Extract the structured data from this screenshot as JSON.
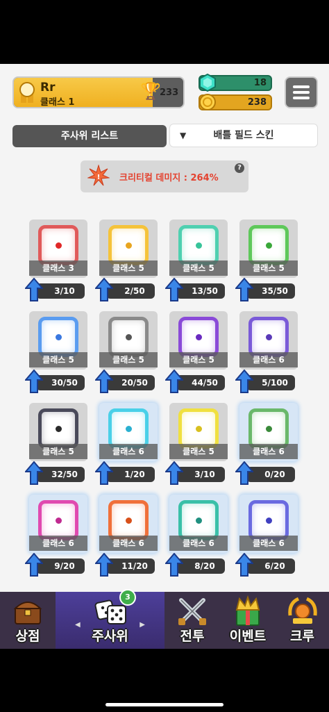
{
  "profile": {
    "name": "Rr",
    "class_label": "클래스 1",
    "trophies": "233",
    "xp_fraction": 0.82
  },
  "currency": {
    "gems": "18",
    "gold": "238"
  },
  "tabs": {
    "dice_list": "주사위 리스트",
    "battle_field_skin": "배틀 필드 스킨"
  },
  "crit": {
    "text": "크리티컬 데미지 : 264%",
    "help": "?"
  },
  "colors": {
    "accent_gold": "#f0b020",
    "gem_green": "#2d8f6a",
    "crit_red": "#e4422f",
    "nav_bg": "#3b3047"
  },
  "dice": [
    {
      "class": "클래스 3",
      "progress": "3/10",
      "color": "#e05a5a",
      "pip": "#e02828",
      "glow": false,
      "icon": "fire-dice-icon"
    },
    {
      "class": "클래스 5",
      "progress": "2/50",
      "color": "#f5c33a",
      "pip": "#e8a520",
      "glow": false,
      "icon": "electric-dice-icon"
    },
    {
      "class": "클래스 5",
      "progress": "13/50",
      "color": "#4fd0b0",
      "pip": "#38c49a",
      "glow": false,
      "icon": "wind-dice-icon"
    },
    {
      "class": "클래스 5",
      "progress": "35/50",
      "color": "#5ec85a",
      "pip": "#3aa83a",
      "glow": false,
      "icon": "poison-dice-icon"
    },
    {
      "class": "클래스 5",
      "progress": "30/50",
      "color": "#5a9cf0",
      "pip": "#3a78e0",
      "glow": false,
      "icon": "ice-dice-icon"
    },
    {
      "class": "클래스 5",
      "progress": "20/50",
      "color": "#8a8a8a",
      "pip": "#555555",
      "glow": false,
      "icon": "iron-dice-icon"
    },
    {
      "class": "클래스 5",
      "progress": "44/50",
      "color": "#8a4ad8",
      "pip": "#6a2ac0",
      "glow": false,
      "icon": "broken-dice-icon"
    },
    {
      "class": "클래스 6",
      "progress": "5/100",
      "color": "#7a5ad8",
      "pip": "#5a3ab8",
      "glow": false,
      "icon": "mystery-dice-icon"
    },
    {
      "class": "클래스 5",
      "progress": "32/50",
      "color": "#4a4a5a",
      "pip": "#2a2a2a",
      "glow": false,
      "icon": "lock-dice-icon"
    },
    {
      "class": "클래스 6",
      "progress": "1/20",
      "color": "#4ad0e8",
      "pip": "#2ab0d0",
      "glow": true,
      "icon": "sparkle-dice-icon"
    },
    {
      "class": "클래스 5",
      "progress": "3/10",
      "color": "#f0e040",
      "pip": "#d8c020",
      "glow": false,
      "icon": "light-dice-icon"
    },
    {
      "class": "클래스 6",
      "progress": "0/20",
      "color": "#6ab86a",
      "pip": "#3a8a3a",
      "glow": true,
      "icon": "thorn-dice-icon"
    },
    {
      "class": "클래스 6",
      "progress": "9/20",
      "color": "#e04ab0",
      "pip": "#c02a90",
      "glow": true,
      "icon": "crack-dice-icon"
    },
    {
      "class": "클래스 6",
      "progress": "11/20",
      "color": "#f0703a",
      "pip": "#d8501a",
      "glow": true,
      "icon": "flame-burst-dice-icon"
    },
    {
      "class": "클래스 6",
      "progress": "8/20",
      "color": "#3ac0a8",
      "pip": "#209080",
      "glow": true,
      "icon": "frost-burst-dice-icon"
    },
    {
      "class": "클래스 6",
      "progress": "6/20",
      "color": "#6a6ae0",
      "pip": "#4040c0",
      "glow": true,
      "icon": "crystal-dice-icon"
    }
  ],
  "nav": {
    "shop": "상점",
    "dice": "주사위",
    "dice_badge": "3",
    "battle": "전투",
    "event": "이벤트",
    "crew": "크루"
  }
}
